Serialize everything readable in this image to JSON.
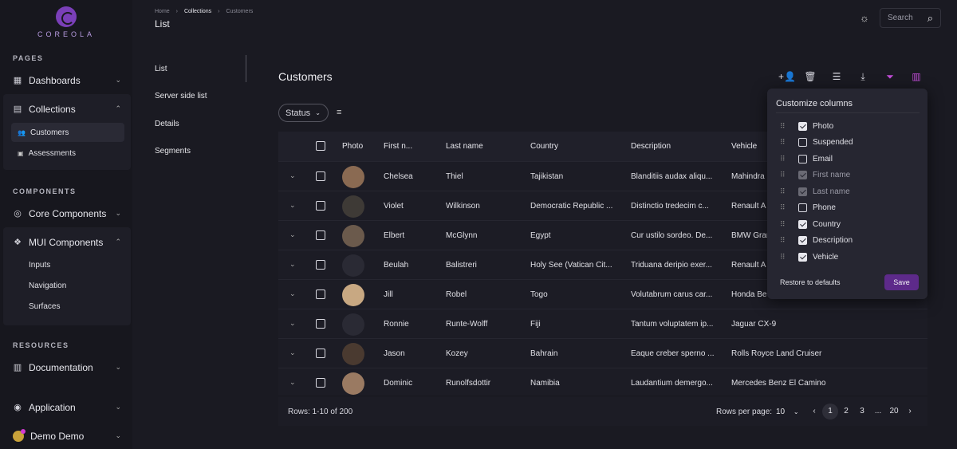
{
  "brand": {
    "name": "COREOLA",
    "accent": "#7a3fb8"
  },
  "sidebar": {
    "pages_title": "PAGES",
    "dashboards": "Dashboards",
    "collections": "Collections",
    "customers": "Customers",
    "assessments": "Assessments",
    "components_title": "COMPONENTS",
    "core_components": "Core Components",
    "mui_components": "MUI Components",
    "inputs": "Inputs",
    "navigation": "Navigation",
    "surfaces": "Surfaces",
    "resources_title": "RESOURCES",
    "documentation": "Documentation",
    "application": "Application",
    "user": "Demo Demo"
  },
  "header": {
    "breadcrumb": [
      "Home",
      "Collections",
      "Customers"
    ],
    "title": "List",
    "search_placeholder": "Search"
  },
  "subnav": [
    "List",
    "Server side list",
    "Details",
    "Segments"
  ],
  "content": {
    "title": "Customers",
    "status_filter": "Status",
    "toolbar_icons": [
      "add-user-icon",
      "delete-icon",
      "search-list-icon",
      "download-icon",
      "filter-icon",
      "columns-icon"
    ]
  },
  "table": {
    "headers": [
      "Photo",
      "First n...",
      "Last name",
      "Country",
      "Description",
      "Vehicle"
    ],
    "rows": [
      {
        "first": "Chelsea",
        "last": "Thiel",
        "country": "Tajikistan",
        "description": "Blanditiis audax aliqu...",
        "vehicle": "Mahindra",
        "photo": "#8a6a52"
      },
      {
        "first": "Violet",
        "last": "Wilkinson",
        "country": "Democratic Republic ...",
        "description": "Distinctio tredecim c...",
        "vehicle": "Renault A",
        "photo": "#3e3a36"
      },
      {
        "first": "Elbert",
        "last": "McGlynn",
        "country": "Egypt",
        "description": "Cur ustilo sordeo. De...",
        "vehicle": "BMW Gran",
        "photo": "#6b5a4c"
      },
      {
        "first": "Beulah",
        "last": "Balistreri",
        "country": "Holy See (Vatican Cit...",
        "description": "Triduana deripio exer...",
        "vehicle": "Renault A",
        "photo": ""
      },
      {
        "first": "Jill",
        "last": "Robel",
        "country": "Togo",
        "description": "Volutabrum carus car...",
        "vehicle": "Honda Be",
        "photo": "#c8a882"
      },
      {
        "first": "Ronnie",
        "last": "Runte-Wolff",
        "country": "Fiji",
        "description": "Tantum voluptatem ip...",
        "vehicle": "Jaguar CX-9",
        "photo": ""
      },
      {
        "first": "Jason",
        "last": "Kozey",
        "country": "Bahrain",
        "description": "Eaque creber sperno ...",
        "vehicle": "Rolls Royce Land Cruiser",
        "photo": "#4a3a30"
      },
      {
        "first": "Dominic",
        "last": "Runolfsdottir",
        "country": "Namibia",
        "description": "Laudantium demergo...",
        "vehicle": "Mercedes Benz El Camino",
        "photo": "#9a7a62"
      }
    ]
  },
  "footer": {
    "rows_text": "Rows: 1-10 of 200",
    "rows_per_page_label": "Rows per page:",
    "rows_per_page_value": "10",
    "pages": [
      "1",
      "2",
      "3",
      "...",
      "20"
    ],
    "current_page": "1"
  },
  "columns_popover": {
    "title": "Customize columns",
    "columns": [
      {
        "label": "Photo",
        "state": "on"
      },
      {
        "label": "Suspended",
        "state": "off"
      },
      {
        "label": "Email",
        "state": "off"
      },
      {
        "label": "First name",
        "state": "disabled"
      },
      {
        "label": "Last name",
        "state": "disabled"
      },
      {
        "label": "Phone",
        "state": "off"
      },
      {
        "label": "Country",
        "state": "on"
      },
      {
        "label": "Description",
        "state": "on"
      },
      {
        "label": "Vehicle",
        "state": "on"
      }
    ],
    "restore_label": "Restore to defaults",
    "save_label": "Save"
  }
}
